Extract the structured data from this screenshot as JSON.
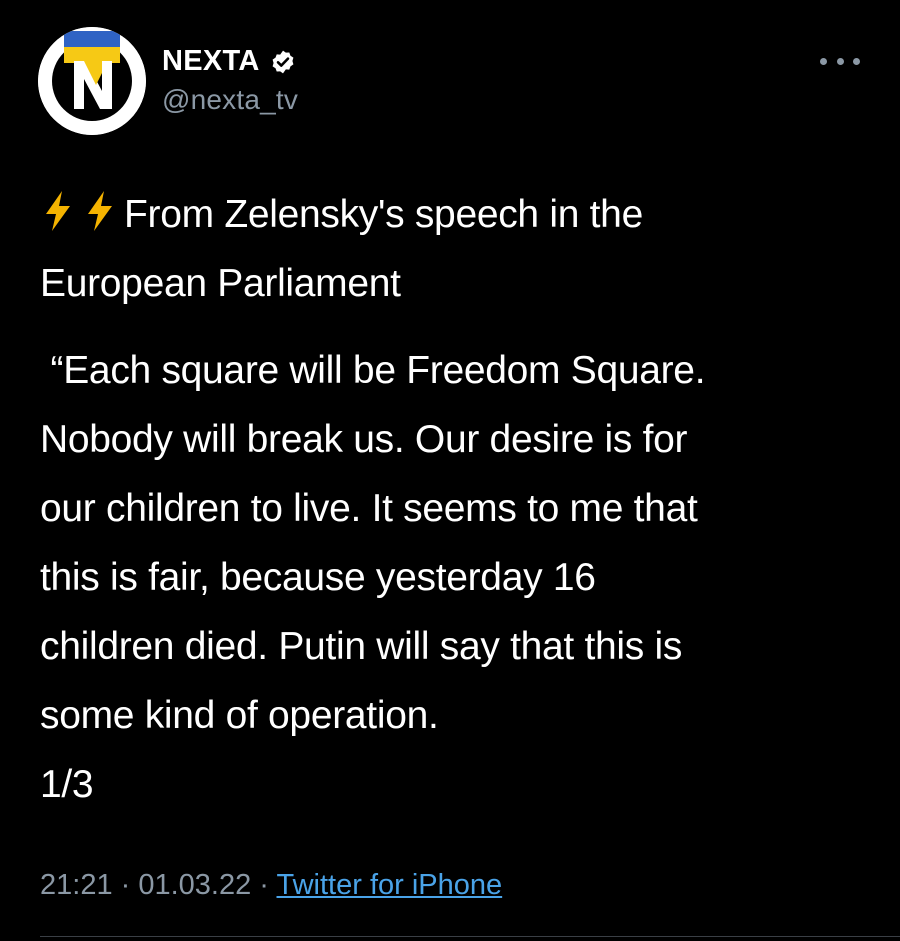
{
  "account": {
    "display_name": "NEXTA",
    "handle": "@nexta_tv",
    "verified": true
  },
  "tweet": {
    "lines": [
      "From Zelensky's speech in the",
      "European Parliament",
      " “Each square will be Freedom Square.",
      "Nobody will break us. Our desire is for",
      "our children to live. It seems to me that",
      "this is fair, because yesterday 16",
      "children died. Putin will say that this is",
      "some kind of operation.",
      "1/3"
    ]
  },
  "meta": {
    "time": "21:21",
    "separator": " · ",
    "date": "01.03.22",
    "source": "Twitter for iPhone"
  },
  "colors": {
    "background": "#000000",
    "text": "#ffffff",
    "secondary": "#8b98a5",
    "link": "#4aa3e8",
    "bolt": "#f5b300",
    "flag_blue": "#2f63c4",
    "flag_yellow": "#f6c915"
  },
  "icons": {
    "avatar": "nexta-logo",
    "verified": "verified-badge-icon",
    "more": "more-options-icon",
    "bolt": "high-voltage-emoji"
  }
}
